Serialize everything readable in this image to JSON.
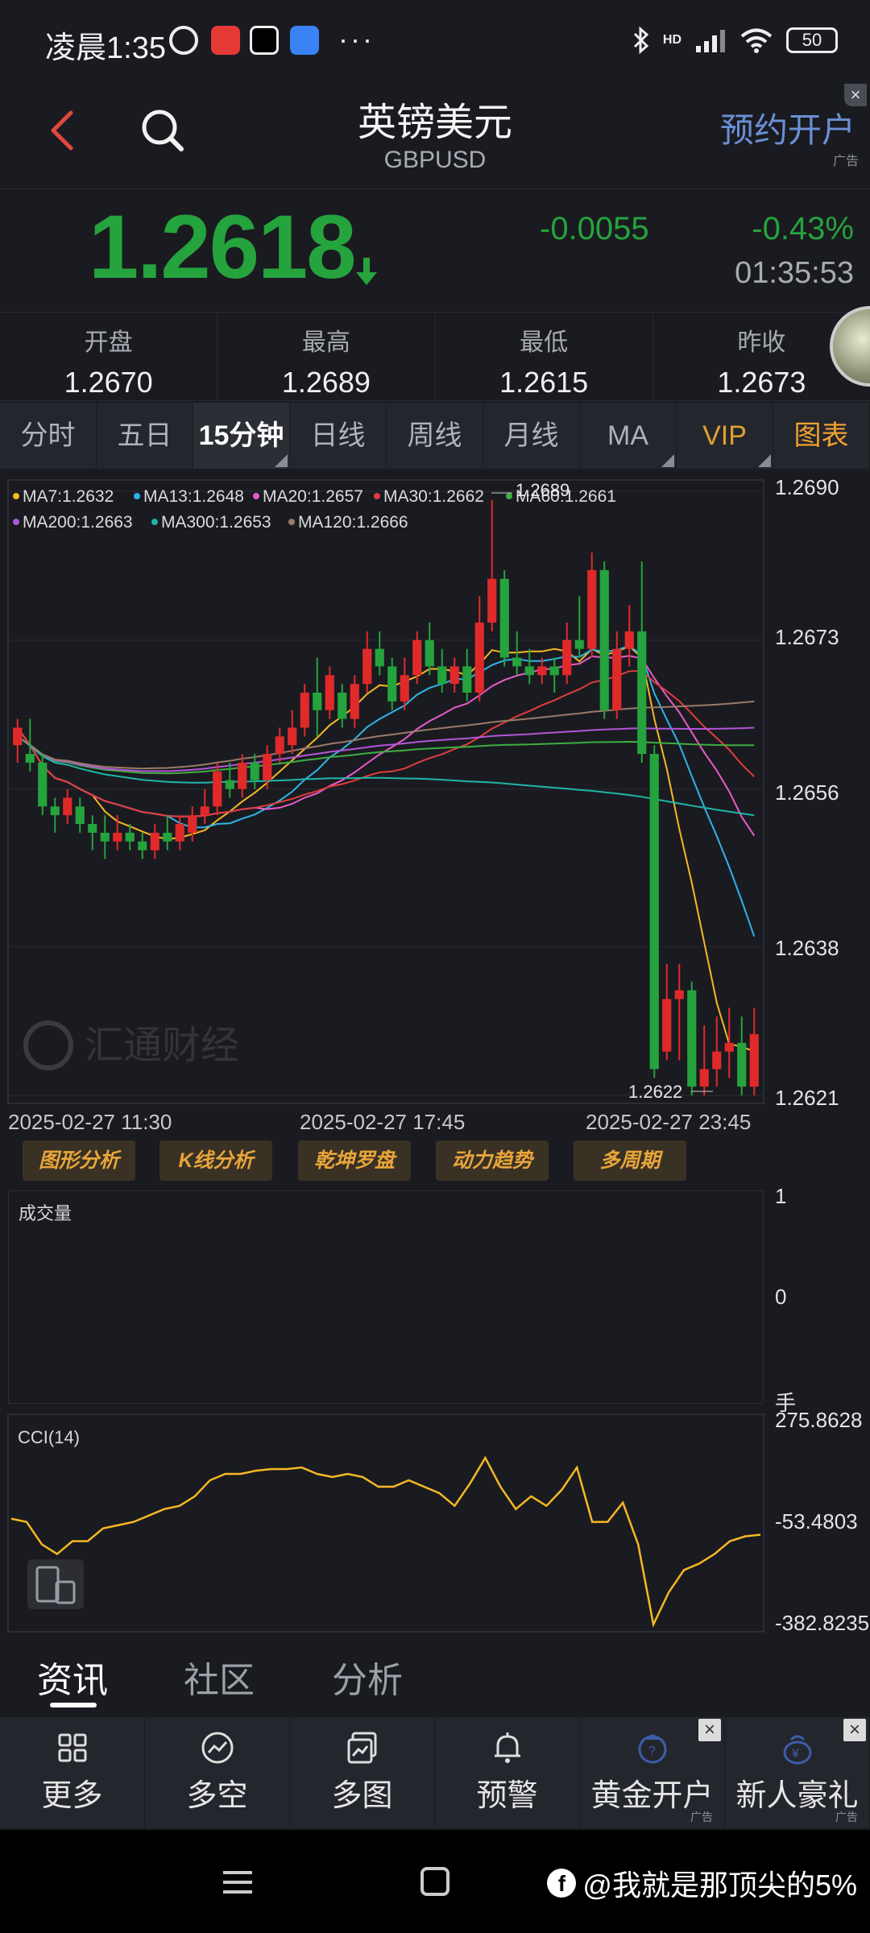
{
  "status_bar": {
    "time": "凌晨1:35",
    "dots": "···",
    "network": "HD",
    "battery": "50"
  },
  "header": {
    "title": "英镑美元",
    "subtitle": "GBPUSD",
    "open_account": "预约开户",
    "ad_tag": "广告"
  },
  "quote": {
    "price": "1.2618",
    "change": "-0.0055",
    "change_pct": "-0.43%",
    "time": "01:35:53",
    "color_down": "#25a33d",
    "color_up": "#e02a2a"
  },
  "ohlc": [
    {
      "label": "开盘",
      "value": "1.2670"
    },
    {
      "label": "最高",
      "value": "1.2689"
    },
    {
      "label": "最低",
      "value": "1.2615"
    },
    {
      "label": "昨收",
      "value": "1.2673"
    }
  ],
  "period_tabs": [
    "分时",
    "五日",
    "15分钟",
    "日线",
    "周线",
    "月线",
    "MA",
    "VIP",
    "图表"
  ],
  "active_tab": "15分钟",
  "chart_data": {
    "type": "candlestick",
    "instrument": "GBPUSD",
    "interval": "15分钟",
    "ylim": [
      1.2621,
      1.269
    ],
    "y_ticks": [
      "1.2690",
      "1.2673",
      "1.2656",
      "1.2638",
      "1.2621"
    ],
    "x_ticks": [
      "2025-02-27 11:30",
      "2025-02-27 17:45",
      "2025-02-27 23:45"
    ],
    "high_marker": "1.2689",
    "low_marker": "1.2622",
    "watermark": "汇通财经",
    "ma_legend": [
      {
        "name": "MA7",
        "value": "1.2632",
        "color": "#f5b824"
      },
      {
        "name": "MA13",
        "value": "1.2648",
        "color": "#2fb3e8"
      },
      {
        "name": "MA20",
        "value": "1.2657",
        "color": "#e95bc8"
      },
      {
        "name": "MA30",
        "value": "1.2662",
        "color": "#e03d3d"
      },
      {
        "name": "MA60",
        "value": "1.2661",
        "color": "#3fae3f"
      },
      {
        "name": "MA200",
        "value": "1.2663",
        "color": "#b455d8"
      },
      {
        "name": "MA300",
        "value": "1.2653",
        "color": "#20b5a8"
      },
      {
        "name": "MA120",
        "value": "1.2666",
        "color": "#9a7a6a"
      }
    ],
    "candles": [
      [
        1.2661,
        1.2663,
        1.2659,
        1.2664
      ],
      [
        1.266,
        1.2659,
        1.2658,
        1.2664
      ],
      [
        1.2659,
        1.2654,
        1.2653,
        1.266
      ],
      [
        1.2654,
        1.2653,
        1.2651,
        1.2655
      ],
      [
        1.2653,
        1.2655,
        1.2652,
        1.2656
      ],
      [
        1.2654,
        1.2652,
        1.2651,
        1.2655
      ],
      [
        1.2652,
        1.2651,
        1.2649,
        1.2653
      ],
      [
        1.2651,
        1.265,
        1.2648,
        1.2653
      ],
      [
        1.265,
        1.2651,
        1.2649,
        1.2653
      ],
      [
        1.2651,
        1.265,
        1.2649,
        1.2652
      ],
      [
        1.265,
        1.2649,
        1.2648,
        1.2651
      ],
      [
        1.2649,
        1.2651,
        1.2648,
        1.2652
      ],
      [
        1.2651,
        1.265,
        1.2649,
        1.2653
      ],
      [
        1.265,
        1.2652,
        1.2649,
        1.2653
      ],
      [
        1.2651,
        1.2653,
        1.265,
        1.2654
      ],
      [
        1.2653,
        1.2654,
        1.2652,
        1.2656
      ],
      [
        1.2654,
        1.2658,
        1.2653,
        1.2659
      ],
      [
        1.2657,
        1.2656,
        1.2655,
        1.2659
      ],
      [
        1.2656,
        1.2659,
        1.2655,
        1.266
      ],
      [
        1.2659,
        1.2657,
        1.2656,
        1.266
      ],
      [
        1.2657,
        1.266,
        1.2656,
        1.2661
      ],
      [
        1.266,
        1.2662,
        1.2659,
        1.2663
      ],
      [
        1.2661,
        1.2663,
        1.266,
        1.2665
      ],
      [
        1.2663,
        1.2667,
        1.2662,
        1.2668
      ],
      [
        1.2667,
        1.2665,
        1.2662,
        1.2671
      ],
      [
        1.2665,
        1.2669,
        1.2664,
        1.267
      ],
      [
        1.2667,
        1.2664,
        1.2663,
        1.2668
      ],
      [
        1.2664,
        1.2668,
        1.2663,
        1.2669
      ],
      [
        1.2668,
        1.2672,
        1.2667,
        1.2674
      ],
      [
        1.2672,
        1.267,
        1.2669,
        1.2674
      ],
      [
        1.267,
        1.2666,
        1.2665,
        1.2671
      ],
      [
        1.2666,
        1.2669,
        1.2665,
        1.2671
      ],
      [
        1.2669,
        1.2673,
        1.2668,
        1.2674
      ],
      [
        1.2673,
        1.267,
        1.2669,
        1.2675
      ],
      [
        1.267,
        1.2668,
        1.2667,
        1.2672
      ],
      [
        1.2668,
        1.267,
        1.2667,
        1.2671
      ],
      [
        1.267,
        1.2667,
        1.2666,
        1.2672
      ],
      [
        1.2667,
        1.2675,
        1.2666,
        1.2678
      ],
      [
        1.2675,
        1.268,
        1.2674,
        1.2689
      ],
      [
        1.268,
        1.2671,
        1.267,
        1.2681
      ],
      [
        1.2671,
        1.267,
        1.2669,
        1.2674
      ],
      [
        1.267,
        1.2669,
        1.2668,
        1.2672
      ],
      [
        1.2669,
        1.267,
        1.2668,
        1.2671
      ],
      [
        1.267,
        1.2669,
        1.2667,
        1.2671
      ],
      [
        1.2669,
        1.2673,
        1.2668,
        1.2675
      ],
      [
        1.2673,
        1.2672,
        1.2671,
        1.2678
      ],
      [
        1.2672,
        1.2681,
        1.2671,
        1.2683
      ],
      [
        1.2681,
        1.2665,
        1.2664,
        1.2682
      ],
      [
        1.2665,
        1.2672,
        1.2664,
        1.2674
      ],
      [
        1.2672,
        1.2674,
        1.267,
        1.2677
      ],
      [
        1.2674,
        1.266,
        1.2659,
        1.2682
      ],
      [
        1.266,
        1.2624,
        1.2623,
        1.2661
      ],
      [
        1.2626,
        1.2632,
        1.2625,
        1.2636
      ],
      [
        1.2632,
        1.2633,
        1.2625,
        1.2636
      ],
      [
        1.2633,
        1.2622,
        1.2621,
        1.2634
      ],
      [
        1.2622,
        1.2624,
        1.2621,
        1.2629
      ],
      [
        1.2624,
        1.2626,
        1.2622,
        1.263
      ],
      [
        1.2626,
        1.2627,
        1.2623,
        1.2631
      ],
      [
        1.2627,
        1.2622,
        1.2621,
        1.263
      ],
      [
        1.2622,
        1.2628,
        1.2621,
        1.2631
      ]
    ]
  },
  "analysis_buttons": [
    "图形分析",
    "K线分析",
    "乾坤罗盘",
    "动力趋势",
    "多周期"
  ],
  "volume": {
    "label": "成交量",
    "y_top": "1",
    "y_mid": "0",
    "unit": "手"
  },
  "cci": {
    "label": "CCI(14)",
    "y_ticks": [
      "275.8628",
      "-53.4803",
      "-382.8235"
    ],
    "ylim": [
      -382.8235,
      275.8628
    ],
    "values": [
      -40,
      -50,
      -120,
      -150,
      -110,
      -110,
      -70,
      -60,
      -50,
      -30,
      -10,
      0,
      30,
      80,
      100,
      100,
      110,
      115,
      115,
      120,
      100,
      90,
      100,
      90,
      60,
      60,
      80,
      60,
      40,
      0,
      70,
      150,
      60,
      -10,
      30,
      0,
      50,
      120,
      -50,
      -50,
      10,
      -120,
      -370,
      -270,
      -200,
      -180,
      -150,
      -110,
      -95,
      -90
    ]
  },
  "info_tabs": [
    "资讯",
    "社区",
    "分析"
  ],
  "bottom_nav": [
    {
      "label": "更多",
      "icon": "grid-icon"
    },
    {
      "label": "多空",
      "icon": "trend-icon"
    },
    {
      "label": "多图",
      "icon": "multi-chart-icon"
    },
    {
      "label": "预警",
      "icon": "bell-icon"
    },
    {
      "label": "黄金开户",
      "icon": "gold-account-icon",
      "ad": "广告"
    },
    {
      "label": "新人豪礼",
      "icon": "gift-bag-icon",
      "ad": "广告"
    }
  ],
  "watermark": "@我就是那顶尖的5%"
}
